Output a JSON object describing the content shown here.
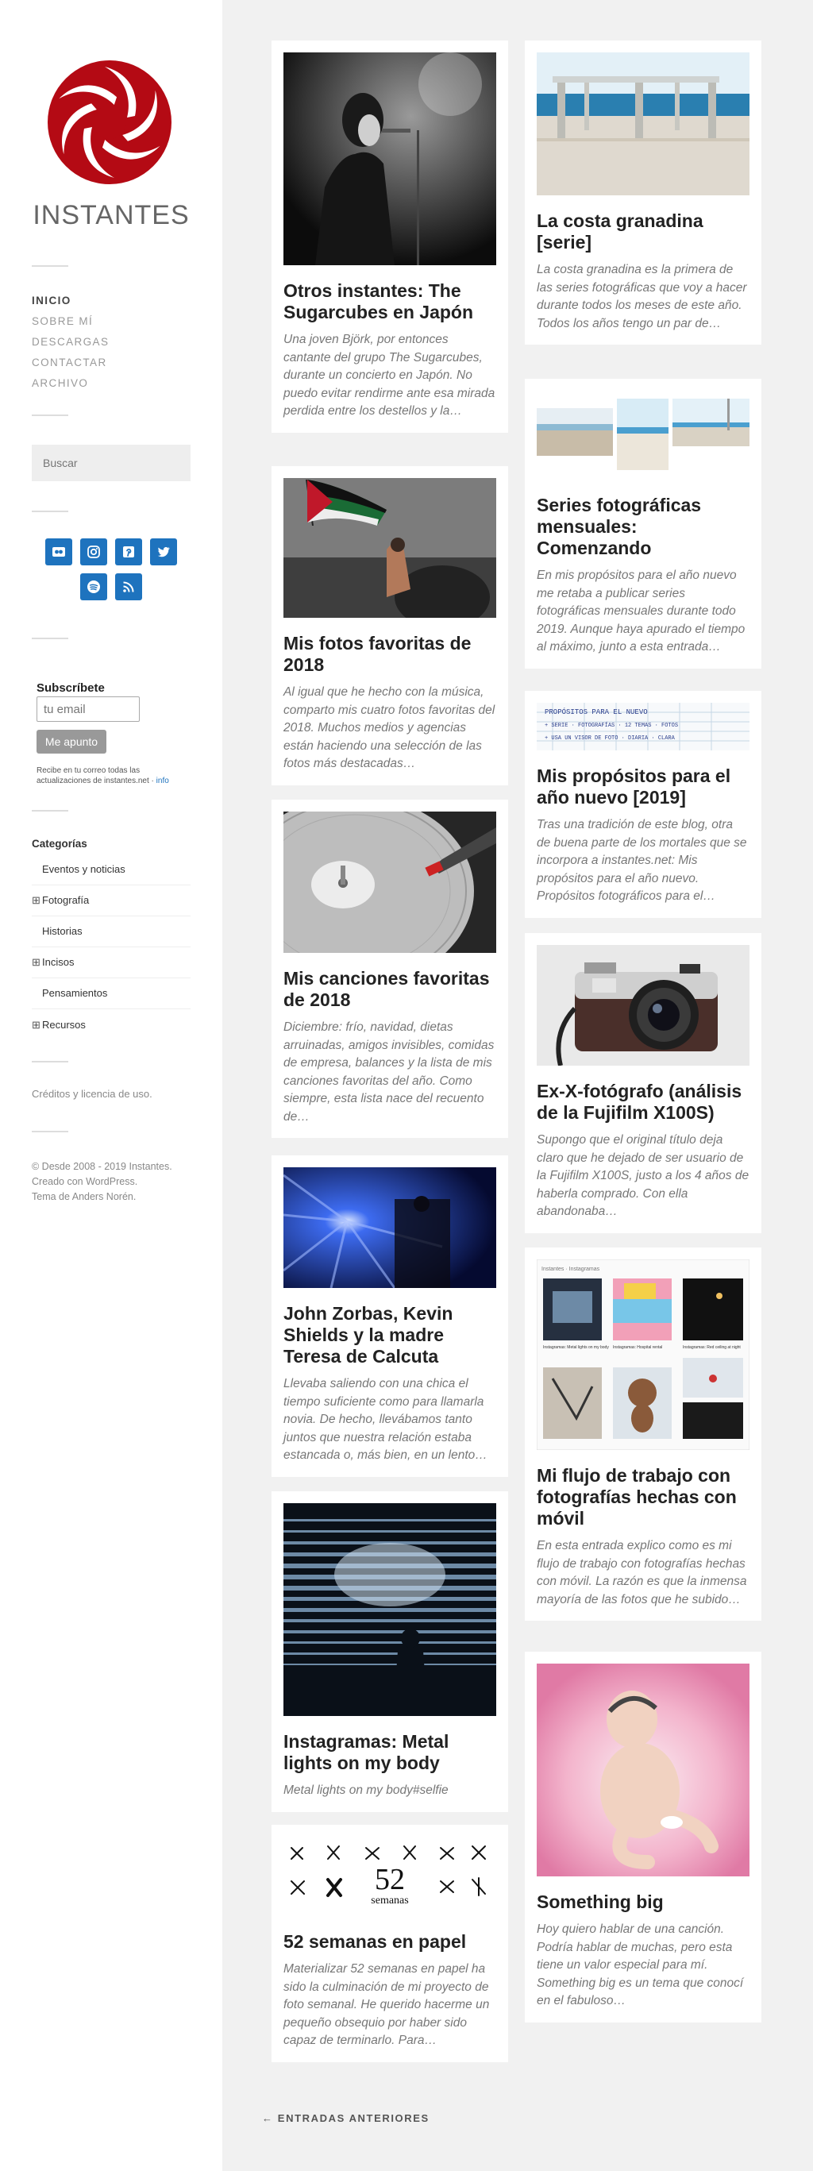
{
  "site": {
    "title": "INSTANTES"
  },
  "nav": [
    "INICIO",
    "SOBRE MÍ",
    "DESCARGAS",
    "CONTACTAR",
    "ARCHIVO"
  ],
  "search": {
    "placeholder": "Buscar"
  },
  "social": [
    "flickr-icon",
    "instagram-icon",
    "pinterest-icon",
    "twitter-icon",
    "spotify-icon",
    "rss-icon"
  ],
  "subscribe": {
    "title": "Subscríbete",
    "email_placeholder": "tu email",
    "button": "Me apunto",
    "note": "Recibe en tu correo todas las actualizaciones de instantes.net ·",
    "info": "info"
  },
  "categories": {
    "title": "Categorías",
    "items": [
      {
        "label": "Eventos y noticias",
        "expandable": false
      },
      {
        "label": "Fotografía",
        "expandable": true
      },
      {
        "label": "Historias",
        "expandable": false
      },
      {
        "label": "Incisos",
        "expandable": true
      },
      {
        "label": "Pensamientos",
        "expandable": false
      },
      {
        "label": "Recursos",
        "expandable": true
      }
    ]
  },
  "credits": "Créditos y licencia de uso.",
  "footer": {
    "line1": "© Desde 2008 - 2019 Instantes.",
    "line2": "Creado con WordPress.",
    "line3": "Tema de Anders Norén."
  },
  "posts": [
    {
      "title": "Otros instantes: The Sugarcubes en Japón",
      "excerpt": "Una joven Björk, por entonces cantante del grupo  The Sugarcubes, durante un concierto en Japón. No puedo evitar rendirme ante esa mirada perdida entre los destellos y la…"
    },
    {
      "title": "La costa granadina [serie]",
      "excerpt": "La costa granadina es la primera de las series fotográficas que voy a hacer durante todos los meses de este año. Todos los años tengo un par de…"
    },
    {
      "title": "Mis fotos favoritas de 2018",
      "excerpt": "Al igual que he hecho con la música, comparto mis cuatro fotos favoritas del 2018. Muchos medios y agencias están haciendo una selección de las fotos más destacadas…"
    },
    {
      "title": "Series fotográficas mensuales: Comenzando",
      "excerpt": "En mis propósitos para el año nuevo me retaba a publicar series fotográficas mensuales durante todo 2019. Aunque haya apurado el tiempo al máximo, junto a esta entrada…"
    },
    {
      "title": "Mis propósitos para el año nuevo [2019]",
      "excerpt": "Tras una tradición de este blog, otra de buena parte de los mortales que se incorpora a instantes.net: Mis propósitos para el año nuevo. Propósitos fotográficos para el…"
    },
    {
      "title": "Mis canciones favoritas de 2018",
      "excerpt": "Diciembre: frío, navidad, dietas arruinadas, amigos invisibles, comidas de empresa, balances y la lista de mis canciones favoritas del año. Como siempre, esta lista nace del recuento de…"
    },
    {
      "title": "Ex-X-fotógrafo (análisis de la Fujifilm X100S)",
      "excerpt": "Supongo que el original título deja claro que he dejado de ser usuario de la Fujifilm X100S, justo a los 4 años de haberla comprado. Con ella abandonaba…"
    },
    {
      "title": "John Zorbas, Kevin Shields y la madre Teresa de Calcuta",
      "excerpt": "Llevaba saliendo con una chica el tiempo suficiente como para llamarla novia. De hecho, llevábamos tanto juntos que nuestra relación estaba estancada o, más bien, en un lento…"
    },
    {
      "title": "Mi flujo de trabajo con fotografías hechas con móvil",
      "excerpt": "En esta entrada explico como es mi flujo de trabajo con fotografías hechas con móvil. La razón es que la inmensa mayoría de las fotos que he subido…"
    },
    {
      "title": "Instagramas: Metal lights on my body",
      "excerpt": "Metal lights on my body#selfie"
    },
    {
      "title": "Something big",
      "excerpt": "Hoy quiero hablar de una canción. Podría hablar de muchas, pero esta tiene un valor especial para mí. Something big es un tema que conocí en el fabuloso…"
    },
    {
      "title": "52 semanas en papel",
      "excerpt": "Materializar 52 semanas en papel ha sido la culminación de mi proyecto de foto semanal. He querido hacerme un pequeño obsequio por haber sido capaz de terminarlo. Para…"
    }
  ],
  "artwork": {
    "notebook_line1": "PROPÓSITOS PARA EL NUEVO",
    "notebook_line2": "+ SERIE · FOTOGRAFÍAS · 12 TEMAS · FOTOS",
    "notebook_line3": "+ USA UN VISOR DE FOTO · DIARIA · CLARA",
    "book_number": "52",
    "book_word": "semanas",
    "workflow_header": "Instantes · Instagramas",
    "workflow_captions": [
      "Instagramas: Metal lights on my body",
      "Instagramas: Hospital rental",
      "Instagramas: Red ceiling at night"
    ]
  },
  "pagination": {
    "older": "← ENTRADAS ANTERIORES"
  }
}
